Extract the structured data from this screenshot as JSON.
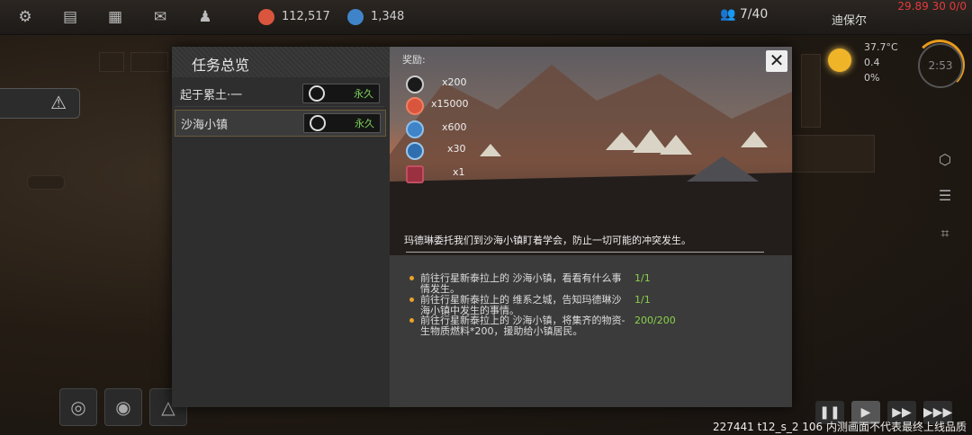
{
  "topbar": {
    "resource1": "112,517",
    "resource2": "1,348",
    "colonists": "7/40",
    "location": "迪保尔",
    "debug": "29.89 30 0/0"
  },
  "weather": {
    "temp": "37.7°C",
    "wind": "0.4",
    "rain": "0%",
    "clock": "2:53"
  },
  "dialog": {
    "title": "任务总览",
    "quests": [
      {
        "name": "起于累土·一",
        "tag": "永久"
      },
      {
        "name": "沙海小镇",
        "tag": "永久"
      }
    ],
    "reward_label": "奖励:",
    "rewards": [
      {
        "icon": "star-chip-icon",
        "amount": "x200"
      },
      {
        "icon": "red-coin-icon",
        "amount": "x15000"
      },
      {
        "icon": "blue-coin-icon",
        "amount": "x600"
      },
      {
        "icon": "blue-gear-icon",
        "amount": "x30"
      },
      {
        "icon": "red-item-icon",
        "amount": "x1"
      }
    ],
    "description": "玛德琳委托我们到沙海小镇盯着学会，防止一切可能的冲突发生。",
    "objectives": [
      {
        "text": "前往行星新泰拉上的 沙海小镇，看看有什么事情发生。",
        "progress": "1/1"
      },
      {
        "text": "前往行星新泰拉上的 维系之城，告知玛德琳沙海小镇中发生的事情。",
        "progress": "1/1"
      },
      {
        "text": "前往行星新泰拉上的 沙海小镇，将集齐的物资-生物质燃料*200，援助给小镇居民。",
        "progress": "200/200"
      }
    ]
  },
  "footer": {
    "build_info": "227441 t12_s_2 106  内测画面不代表最终上线品质"
  },
  "colors": {
    "accent": "#e9a32a",
    "progress": "#8bd24a",
    "perm": "#7fd35a"
  }
}
